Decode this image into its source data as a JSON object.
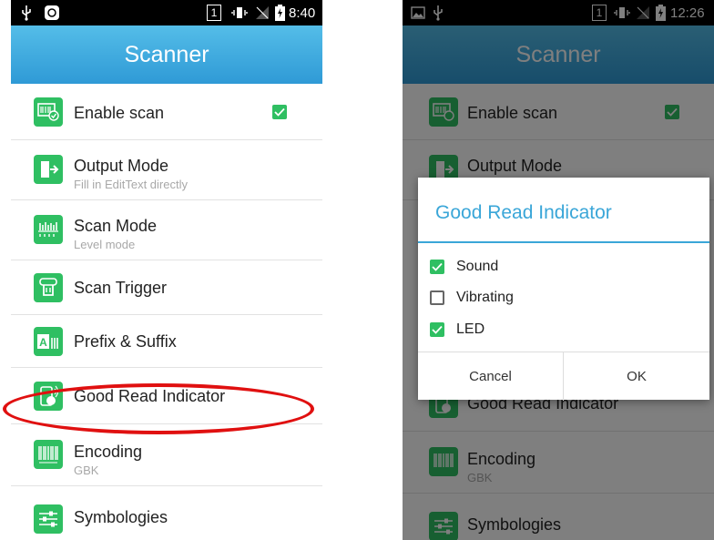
{
  "left": {
    "status_time": "8:40",
    "sim_slot": "1",
    "app_title": "Scanner",
    "items": [
      {
        "title": "Enable scan",
        "subtitle": "",
        "icon": "scan-barcode-icon"
      },
      {
        "title": "Output Mode",
        "subtitle": "Fill in EditText directly",
        "icon": "output-door-icon"
      },
      {
        "title": "Scan Mode",
        "subtitle": "Level mode",
        "icon": "scan-mode-icon"
      },
      {
        "title": "Scan Trigger",
        "subtitle": "",
        "icon": "trigger-hand-icon"
      },
      {
        "title": "Prefix & Suffix",
        "subtitle": "",
        "icon": "prefix-suffix-icon"
      },
      {
        "title": "Good Read Indicator",
        "subtitle": "",
        "icon": "good-read-phone-icon"
      },
      {
        "title": "Encoding",
        "subtitle": "GBK",
        "icon": "barcode-icon"
      },
      {
        "title": "Symbologies",
        "subtitle": "",
        "icon": "sliders-icon"
      }
    ],
    "enable_scan_checked": true
  },
  "right": {
    "status_time": "12:26",
    "sim_slot": "1",
    "app_title": "Scanner",
    "items": [
      {
        "title": "Enable scan",
        "subtitle": ""
      },
      {
        "title": "Output Mode",
        "subtitle": ""
      },
      {
        "title": "Good Read Indicator",
        "subtitle": ""
      },
      {
        "title": "Encoding",
        "subtitle": "GBK"
      },
      {
        "title": "Symbologies",
        "subtitle": ""
      }
    ],
    "dialog": {
      "title": "Good Read Indicator",
      "options": [
        {
          "label": "Sound",
          "checked": true
        },
        {
          "label": "Vibrating",
          "checked": false
        },
        {
          "label": "LED",
          "checked": true
        }
      ],
      "cancel_label": "Cancel",
      "ok_label": "OK"
    }
  },
  "colors": {
    "accent": "#3aa6d8",
    "appbar": "#2f9ad6",
    "icon_green": "#2fbf62",
    "highlight": "#e01010"
  }
}
